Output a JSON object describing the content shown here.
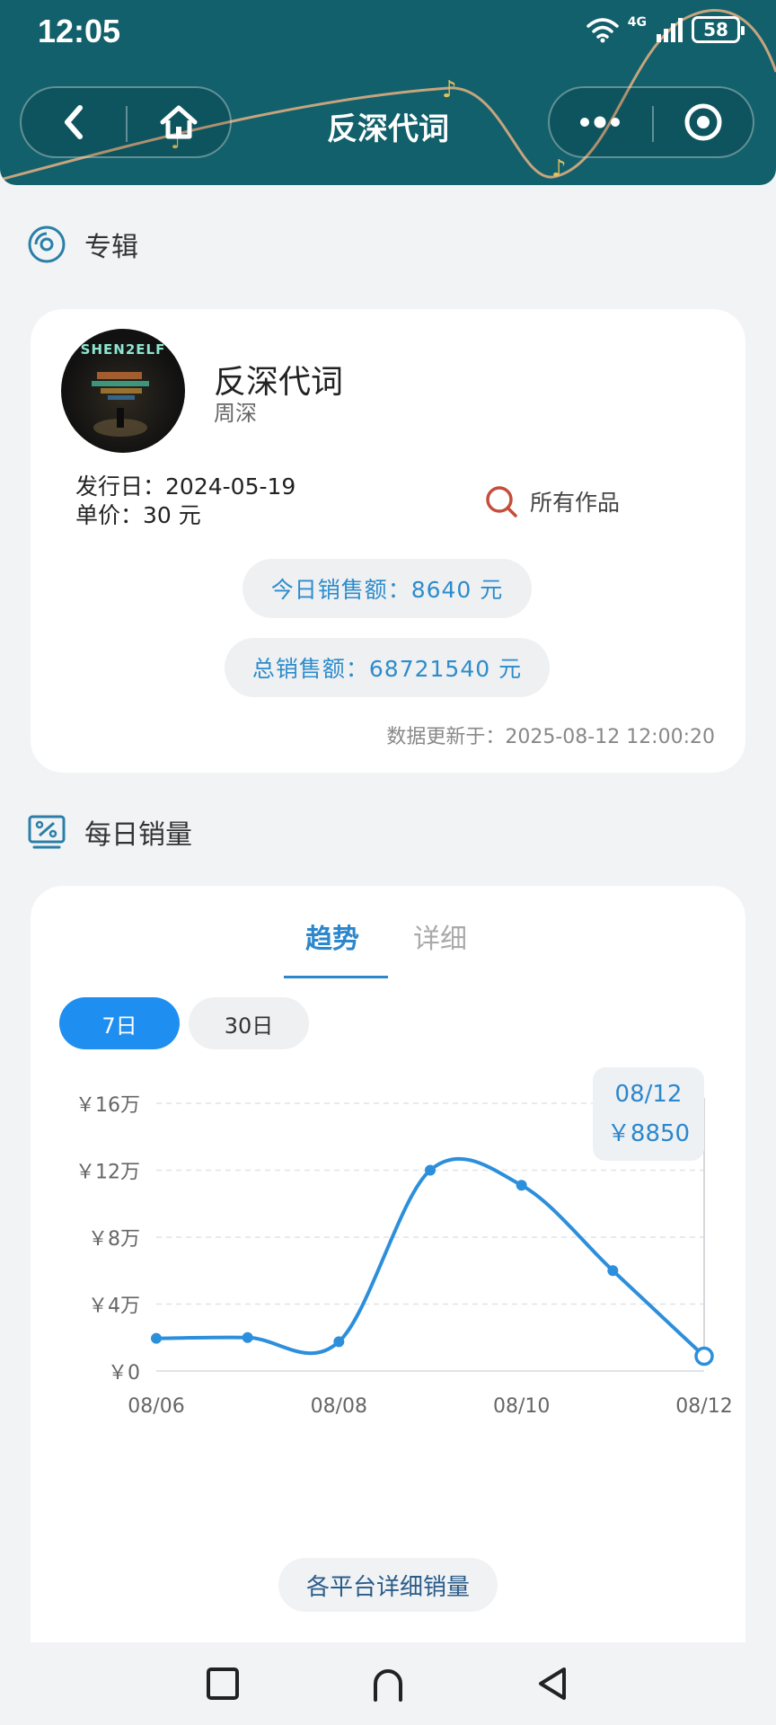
{
  "status_bar": {
    "time": "12:05",
    "network": "4G",
    "battery": "58"
  },
  "header": {
    "title": "反深代词",
    "back_icon": "chevron-left-icon",
    "home_icon": "home-icon",
    "more_icon": "more-dots-icon",
    "close_icon": "target-circle-icon"
  },
  "album_section": {
    "heading": "专辑",
    "icon": "disc-icon"
  },
  "album": {
    "cover_text": "SHEN2ELF",
    "name": "反深代词",
    "artist": "周深",
    "release_label": "发行日：",
    "release_date": "2024-05-19",
    "price_label": "单价：",
    "price": "30 元",
    "all_works": "所有作品",
    "today_sales": "今日销售额：8640 元",
    "total_sales": "总销售额：68721540 元",
    "updated": "数据更新于：2025-08-12 12:00:20"
  },
  "daily_section": {
    "heading": "每日销量",
    "icon": "chart-percent-icon"
  },
  "chart_panel": {
    "tabs": [
      "趋势",
      "详细"
    ],
    "active_tab": "趋势",
    "ranges": [
      "7日",
      "30日"
    ],
    "active_range": "7日",
    "tooltip_date": "08/12",
    "tooltip_value": "￥8850",
    "detail_button": "各平台详细销量"
  },
  "chart_data": {
    "type": "line",
    "x": [
      "08/06",
      "08/07",
      "08/08",
      "08/09",
      "08/10",
      "08/11",
      "08/12"
    ],
    "x_tick_labels": [
      "08/06",
      "08/08",
      "08/10",
      "08/12"
    ],
    "values": [
      19500,
      20000,
      17500,
      120000,
      111000,
      60000,
      8850
    ],
    "y_tick_labels": [
      "￥0",
      "￥4万",
      "￥8万",
      "￥12万",
      "￥16万"
    ],
    "y_ticks": [
      0,
      40000,
      80000,
      120000,
      160000
    ],
    "ylim": [
      0,
      160000
    ],
    "grid": true,
    "color": "#2c8fdc",
    "highlight_index": 6
  },
  "bottom_nav": {
    "icons": [
      "square-icon",
      "home-arc-icon",
      "back-triangle-icon"
    ]
  }
}
